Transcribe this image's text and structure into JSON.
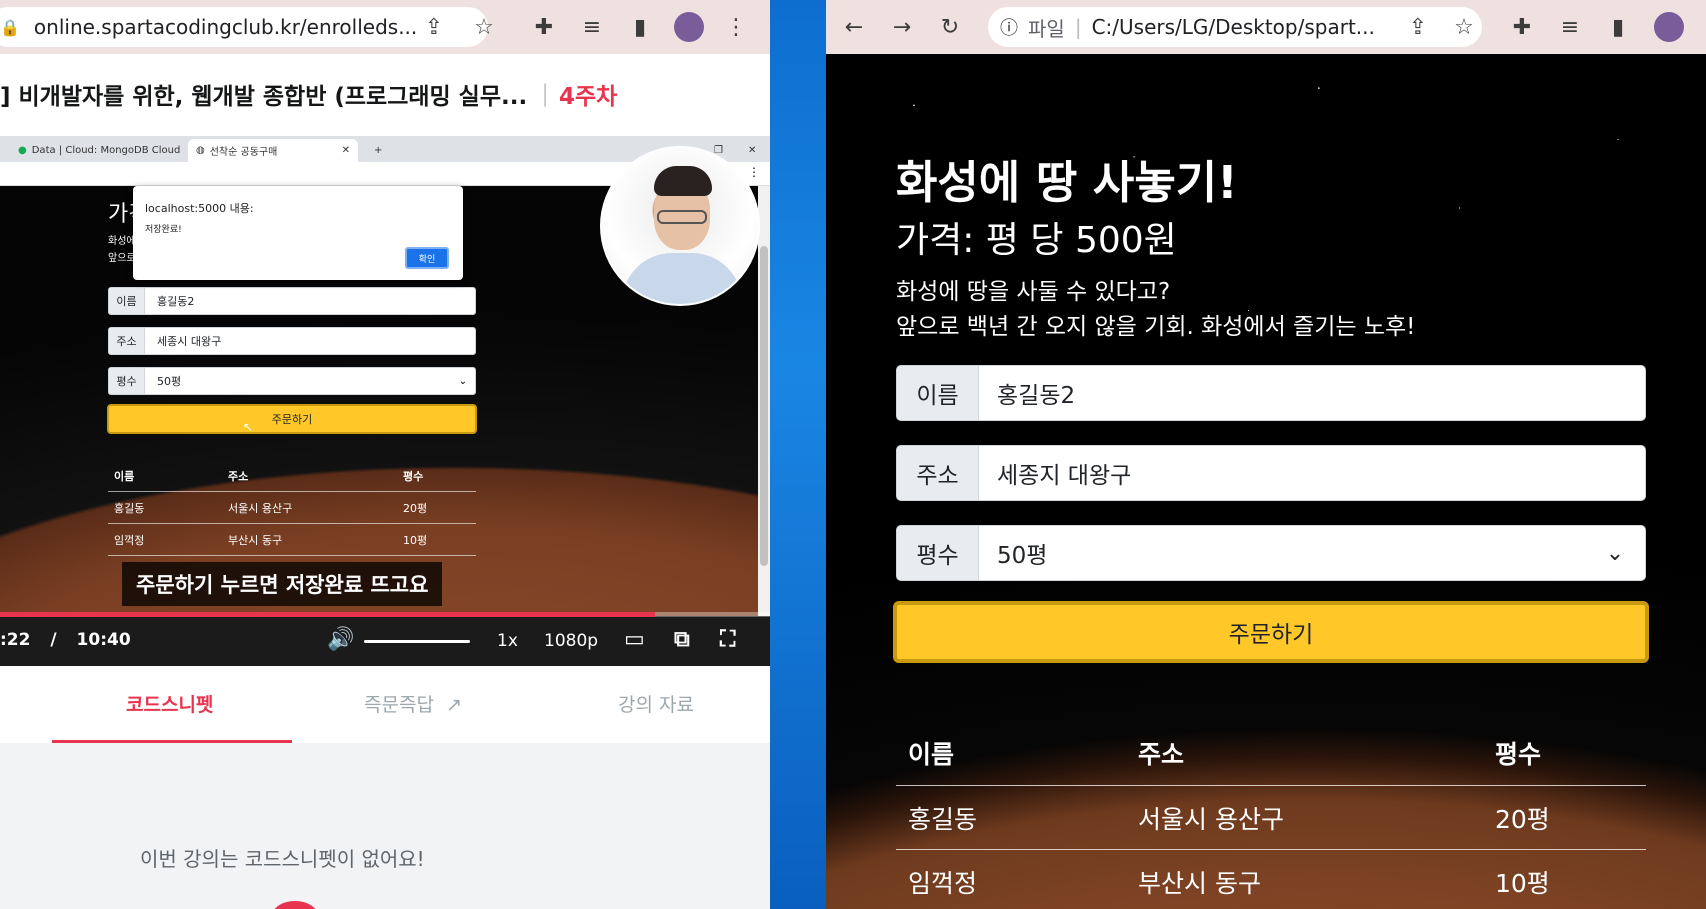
{
  "left": {
    "url": "online.spartacodingclub.kr/enrolleds...",
    "course": {
      "title": "] 비개발자를 위한, 웹개발 종합반 (프로그래밍 실무...",
      "separator": "|",
      "week": "4주차"
    },
    "video": {
      "tabs": [
        "Data | Cloud: MongoDB Cloud",
        "선착순 공동구매"
      ],
      "new_tab": "+",
      "alert": {
        "title": "localhost:5000 내용:",
        "message": "저장완료!",
        "ok": "확인"
      },
      "heading_fragment": "가격",
      "text_fragment_1": "화성에",
      "text_fragment_2": "앞으로",
      "form": {
        "name_label": "이름",
        "name_value": "홍길동2",
        "address_label": "주소",
        "address_value": "세종시 대왕구",
        "size_label": "평수",
        "size_value": "50평",
        "order_button": "주문하기"
      },
      "table": {
        "headers": [
          "이름",
          "주소",
          "평수"
        ],
        "rows": [
          [
            "홍길동",
            "서울시 용산구",
            "20평"
          ],
          [
            "임꺽정",
            "부산시 동구",
            "10평"
          ]
        ]
      },
      "subtitle": "주문하기 누르면 저장완료 뜨고요",
      "progress": 0.85,
      "time_current": ":22",
      "time_separator": "/",
      "time_total": "10:40",
      "speed": "1x",
      "quality": "1080p"
    },
    "tabs": {
      "code": "코드스니펫",
      "qa": "즉문즉답",
      "materials": "강의 자료"
    },
    "empty_message": "이번 강의는 코드스니펫이 없어요!"
  },
  "right": {
    "url_label": "파일",
    "url": "C:/Users/LG/Desktop/spart...",
    "h1": "화성에 땅 사놓기!",
    "h2": "가격: 평 당 500원",
    "p1": "화성에 땅을 사둘 수 있다고?",
    "p2": "앞으로 백년 간 오지 않을 기회. 화성에서 즐기는 노후!",
    "form": {
      "name_label": "이름",
      "name_value": "홍길동2",
      "address_label": "주소",
      "address_value": "세종지 대왕구",
      "size_label": "평수",
      "size_value": "50평",
      "order_button": "주문하기"
    },
    "table": {
      "headers": [
        "이름",
        "주소",
        "평수"
      ],
      "rows": [
        [
          "홍길동",
          "서울시 용산구",
          "20평"
        ],
        [
          "임꺽정",
          "부산시 동구",
          "10평"
        ]
      ]
    }
  }
}
